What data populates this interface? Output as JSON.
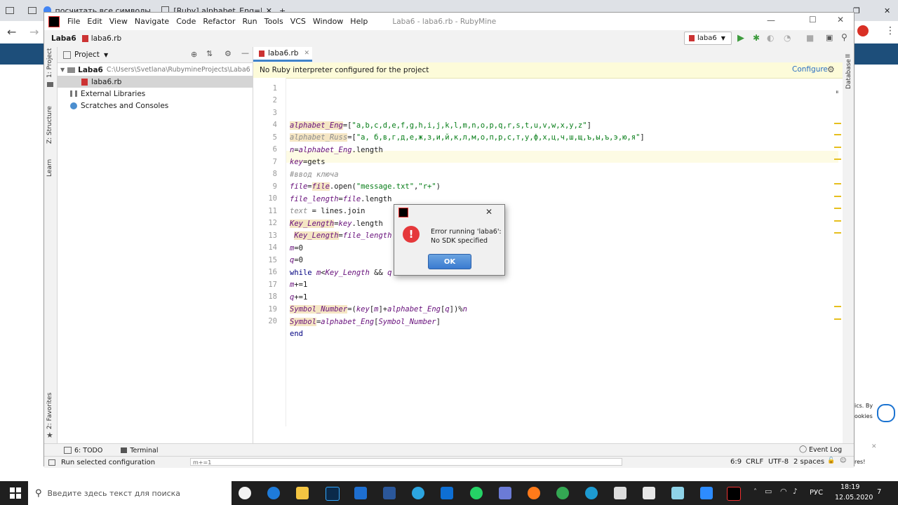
{
  "browser": {
    "tabs": [
      {
        "label": "посчитать все символы rul"
      },
      {
        "label": "[Ruby] alphabet_Eng=[\""
      }
    ],
    "right_text_1": "ics. By",
    "right_text_2": "ookies",
    "right_text_3": "res!"
  },
  "ide": {
    "window_title": "Laba6 - laba6.rb - RubyMine",
    "menu": [
      "File",
      "Edit",
      "View",
      "Navigate",
      "Code",
      "Refactor",
      "Run",
      "Tools",
      "VCS",
      "Window",
      "Help"
    ],
    "breadcrumb": {
      "project": "Laba6",
      "file": "laba6.rb"
    },
    "run_config": "laba6",
    "left_tabs": {
      "project": "1: Project",
      "structure": "Z: Structure",
      "learn": "Learn",
      "favorites": "2: Favorites"
    },
    "right_tabs": {
      "database": "Database"
    },
    "project_panel": {
      "title": "Project",
      "tree": [
        {
          "label": "Laba6",
          "path": "C:\\Users\\Svetlana\\RubymineProjects\\Laba6"
        },
        {
          "label": "laba6.rb"
        },
        {
          "label": "External Libraries"
        },
        {
          "label": "Scratches and Consoles"
        }
      ]
    },
    "editor": {
      "tab": "laba6.rb",
      "banner_text": "No Ruby interpreter configured for the project",
      "banner_action": "Configure",
      "lines": [
        "1",
        "2",
        "3",
        "4",
        "5",
        "6",
        "7",
        "8",
        "9",
        "10",
        "11",
        "12",
        "13",
        "14",
        "15",
        "16",
        "17",
        "18",
        "19",
        "20"
      ]
    },
    "bottom_tools": {
      "todo": "6: TODO",
      "terminal": "Terminal",
      "event_log": "Event Log"
    },
    "status": {
      "message": "Run selected configuration",
      "position": "6:9",
      "line_sep": "CRLF",
      "encoding": "UTF-8",
      "indent": "2 spaces",
      "bg_text": "m+=1"
    }
  },
  "dialog": {
    "line1": "Error running 'laba6':",
    "line2": "No SDK specified",
    "ok": "OK"
  },
  "taskbar": {
    "search_placeholder": "Введите здесь текст для поиска",
    "lang": "РУС",
    "time": "18:19",
    "date": "12.05.2020",
    "notifications": "7"
  },
  "colors": {
    "accent": "#3a7bd0",
    "banner": "#fdfbd9",
    "error": "#e5383b"
  }
}
